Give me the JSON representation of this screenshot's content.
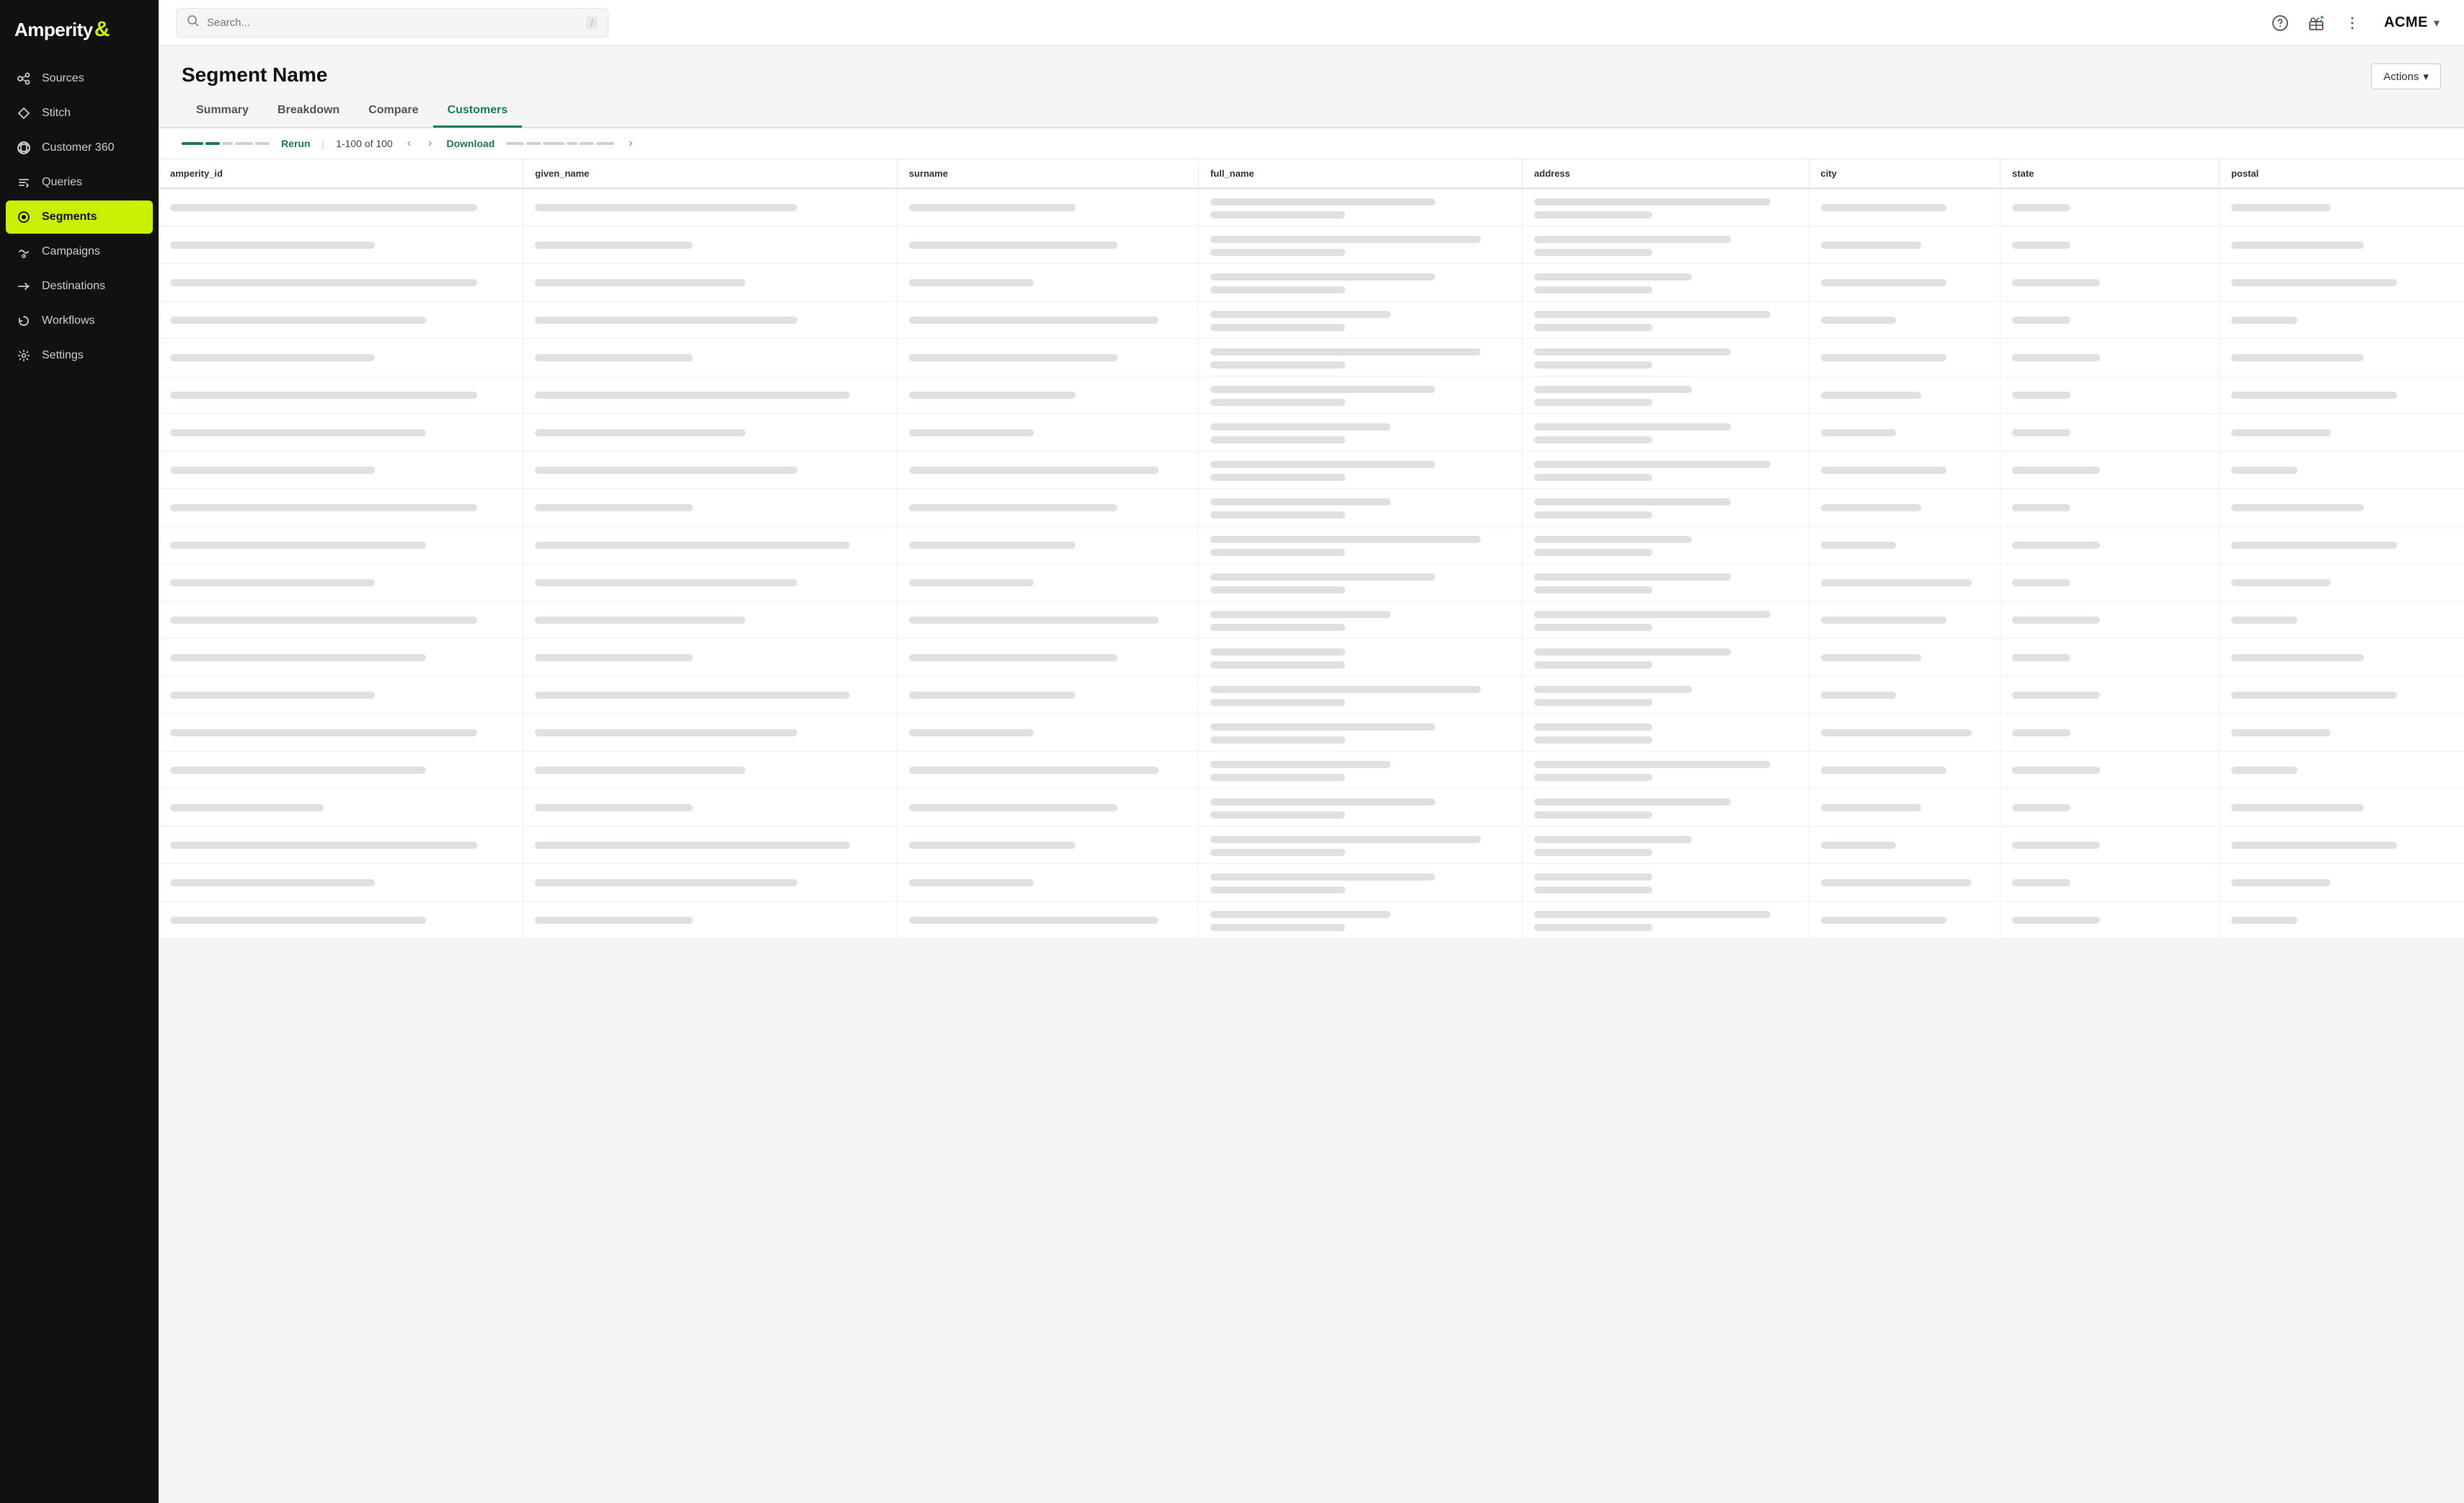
{
  "app": {
    "logo_text": "Amperity",
    "logo_symbol": "&"
  },
  "sidebar": {
    "items": [
      {
        "id": "sources",
        "label": "Sources",
        "icon": "sources-icon",
        "active": false
      },
      {
        "id": "stitch",
        "label": "Stitch",
        "icon": "stitch-icon",
        "active": false
      },
      {
        "id": "customer360",
        "label": "Customer 360",
        "icon": "customer360-icon",
        "active": false
      },
      {
        "id": "queries",
        "label": "Queries",
        "icon": "queries-icon",
        "active": false
      },
      {
        "id": "segments",
        "label": "Segments",
        "icon": "segments-icon",
        "active": true
      },
      {
        "id": "campaigns",
        "label": "Campaigns",
        "icon": "campaigns-icon",
        "active": false
      },
      {
        "id": "destinations",
        "label": "Destinations",
        "icon": "destinations-icon",
        "active": false
      },
      {
        "id": "workflows",
        "label": "Workflows",
        "icon": "workflows-icon",
        "active": false
      },
      {
        "id": "settings",
        "label": "Settings",
        "icon": "settings-icon",
        "active": false
      }
    ]
  },
  "topbar": {
    "search_placeholder": "/",
    "account_name": "ACME"
  },
  "page": {
    "title": "Segment Name",
    "actions_label": "Actions",
    "tabs": [
      {
        "id": "summary",
        "label": "Summary",
        "active": false
      },
      {
        "id": "breakdown",
        "label": "Breakdown",
        "active": false
      },
      {
        "id": "compare",
        "label": "Compare",
        "active": false
      },
      {
        "id": "customers",
        "label": "Customers",
        "active": true
      }
    ],
    "pagination": {
      "rerun": "Rerun",
      "count": "1-100 of 100",
      "download": "Download"
    },
    "table": {
      "columns": [
        "amperity_id",
        "given_name",
        "surname",
        "full_name",
        "address",
        "city",
        "state",
        "postal"
      ]
    }
  }
}
